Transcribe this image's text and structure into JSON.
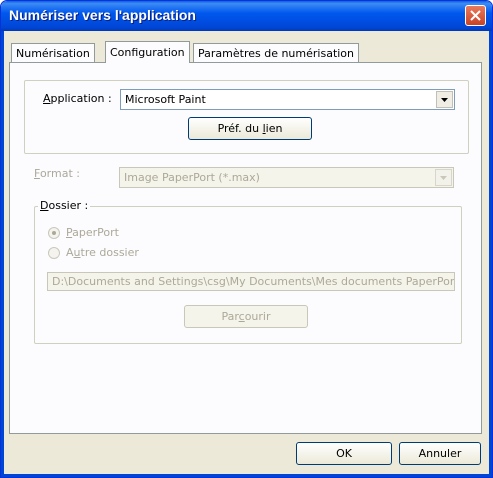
{
  "window": {
    "title": "Numériser vers l'application"
  },
  "tabs": [
    {
      "label": "Numérisation"
    },
    {
      "label": "Configuration"
    },
    {
      "label": "Paramètres de numérisation"
    }
  ],
  "application": {
    "label_prefix": "",
    "label_mnemonic": "A",
    "label_rest": "pplication :",
    "value": "Microsoft Paint",
    "link_button_pre": "Préf. du ",
    "link_button_mnemonic": "l",
    "link_button_post": "ien"
  },
  "format": {
    "label_mnemonic": "F",
    "label_rest": "ormat :",
    "value": "Image PaperPort (*.max)"
  },
  "folder": {
    "label_mnemonic": "D",
    "label_rest": "ossier :",
    "option1_mnemonic": "P",
    "option1_rest": "aperPort",
    "option2_pre": "A",
    "option2_mnemonic": "u",
    "option2_rest": "tre dossier",
    "path": "D:\\Documents and Settings\\csg\\My Documents\\Mes documents PaperPort",
    "browse_pre": "Par",
    "browse_mnemonic": "c",
    "browse_post": "ourir"
  },
  "footer": {
    "ok": "OK",
    "cancel": "Annuler"
  },
  "colors": {
    "titlebar": "#0058ee",
    "dialog_bg": "#ece9d8",
    "disabled_text": "#aca899"
  }
}
